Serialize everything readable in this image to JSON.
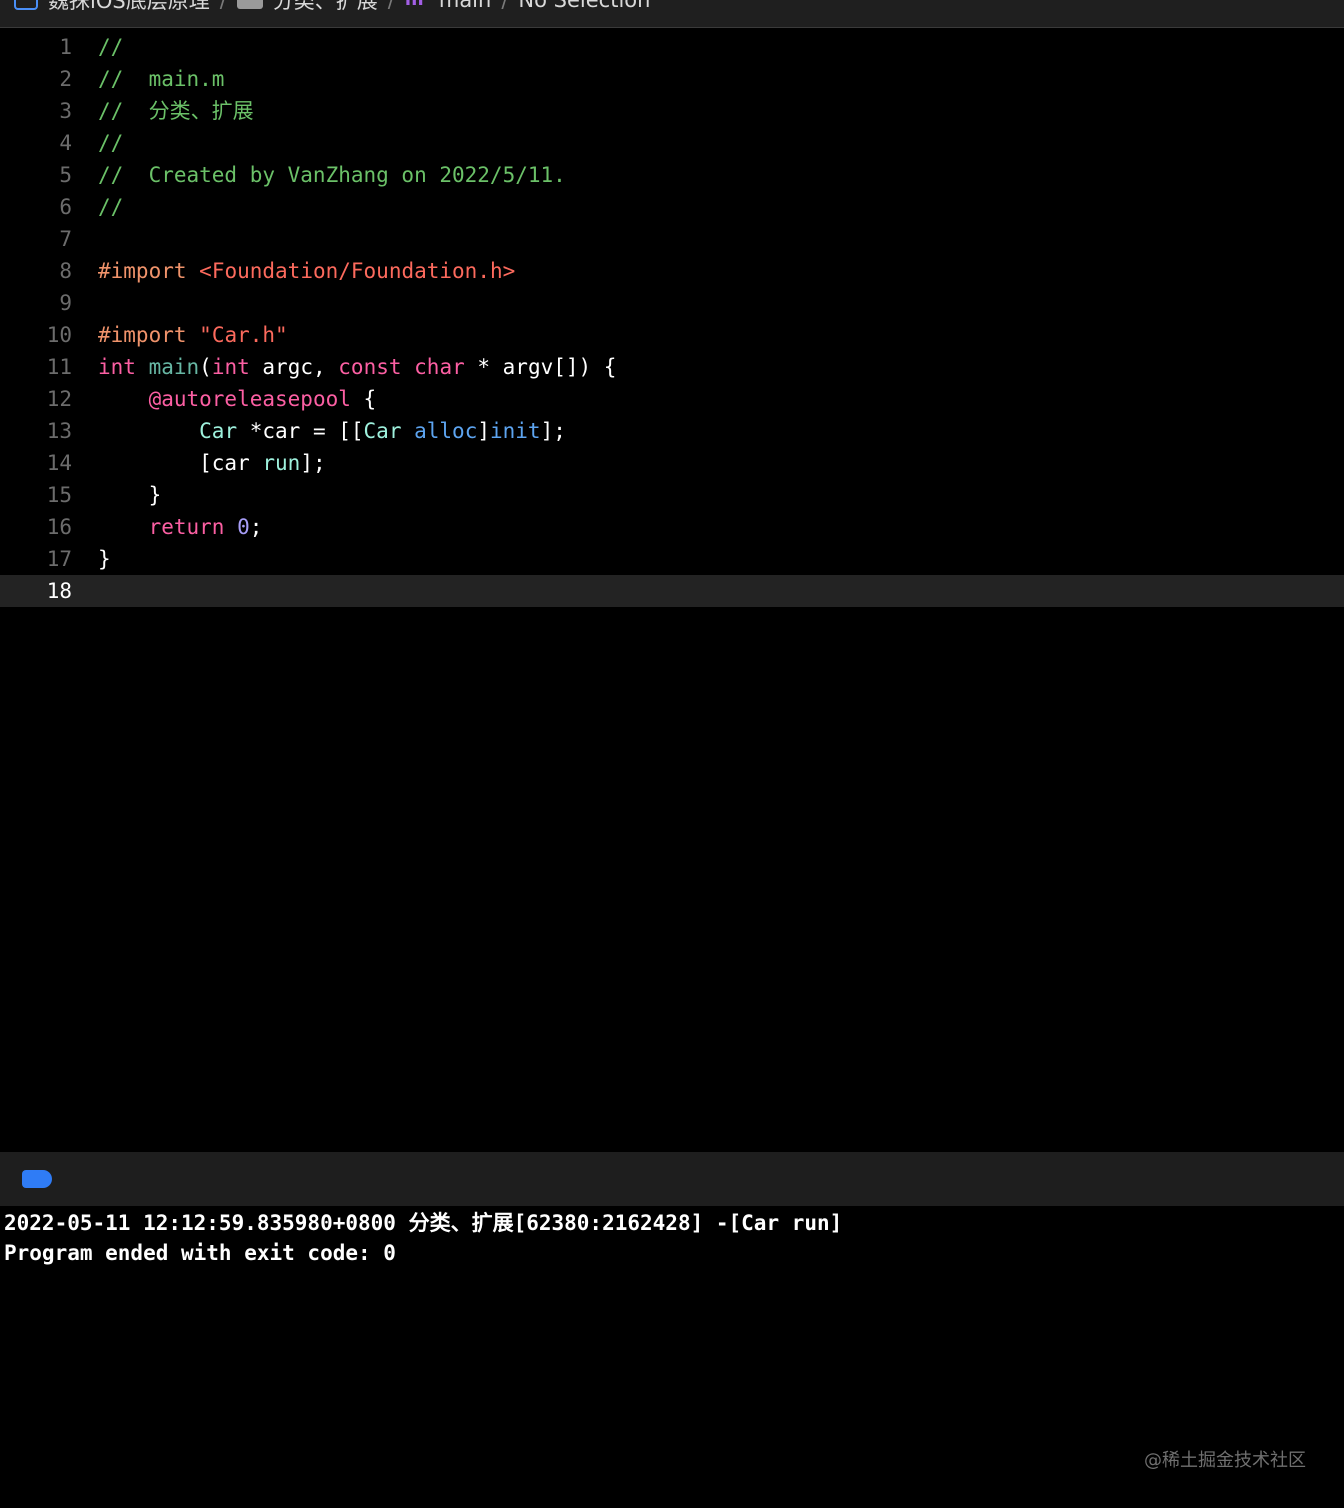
{
  "breadcrumb": {
    "project": "魏抹iOS底层原理",
    "group": "分类、扩展",
    "function": "main",
    "selection": "No Selection",
    "function_icon_glyph": "m"
  },
  "editor": {
    "current_line": "18",
    "lines": [
      {
        "n": "1",
        "t": [
          "//"
        ]
      },
      {
        "n": "2",
        "t": [
          "//  main.m"
        ]
      },
      {
        "n": "3",
        "t": [
          "//  分类、扩展"
        ]
      },
      {
        "n": "4",
        "t": [
          "//"
        ]
      },
      {
        "n": "5",
        "t": [
          "//  Created by VanZhang on 2022/5/11."
        ]
      },
      {
        "n": "6",
        "t": [
          "//"
        ]
      },
      {
        "n": "7",
        "t": []
      },
      {
        "n": "8",
        "t": [
          "#import",
          " ",
          "<Foundation/Foundation.h>"
        ]
      },
      {
        "n": "9",
        "t": []
      },
      {
        "n": "10",
        "t": [
          "#import",
          " ",
          "\"Car.h\""
        ]
      },
      {
        "n": "11",
        "t": [
          "int",
          " ",
          "main",
          "(",
          "int",
          " argc, ",
          "const",
          " ",
          "char",
          " * argv[]) {"
        ]
      },
      {
        "n": "12",
        "t": [
          "    ",
          "@autoreleasepool",
          " {"
        ]
      },
      {
        "n": "13",
        "t": [
          "        ",
          "Car",
          " *car = [[",
          "Car",
          " ",
          "alloc",
          "]",
          "init",
          "];"
        ]
      },
      {
        "n": "14",
        "t": [
          "        [car ",
          "run",
          "];"
        ]
      },
      {
        "n": "15",
        "t": [
          "    }"
        ]
      },
      {
        "n": "16",
        "t": [
          "    ",
          "return",
          " ",
          "0",
          ";"
        ]
      },
      {
        "n": "17",
        "t": [
          "}"
        ]
      },
      {
        "n": "18",
        "t": []
      }
    ]
  },
  "console": {
    "output": [
      "2022-05-11 12:12:59.835980+0800 分类、扩展[62380:2162428] -[Car run]",
      "Program ended with exit code: 0"
    ]
  },
  "watermark": "@稀土掘金技术社区",
  "colors": {
    "comment": "#6bc168",
    "preprocessor": "#f0936b",
    "string": "#fc6a5d",
    "keyword": "#fc5fa3",
    "function": "#67b7a4",
    "class": "#9ef1dd",
    "method": "#41a1c0",
    "number": "#a79df7",
    "console_badge": "#2f7cf6"
  }
}
